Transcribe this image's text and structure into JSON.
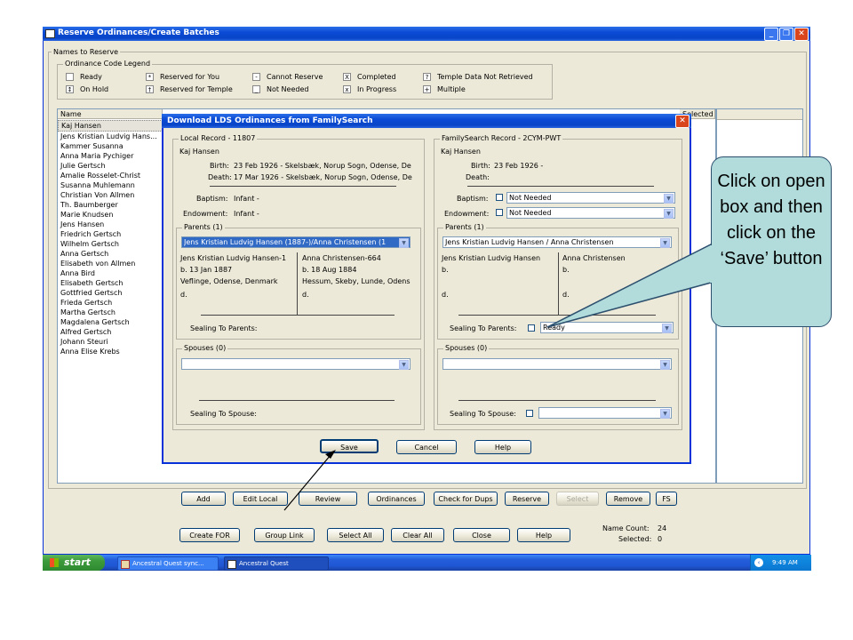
{
  "window": {
    "title": "Reserve Ordinances/Create Batches"
  },
  "names_group": {
    "label": "Names to Reserve"
  },
  "legend": {
    "label": "Ordinance Code Legend",
    "items": [
      {
        "code": "",
        "text": "Ready"
      },
      {
        "code": "*",
        "text": "Reserved for You"
      },
      {
        "code": "-",
        "text": "Cannot Reserve"
      },
      {
        "code": "X",
        "text": "Completed"
      },
      {
        "code": "?",
        "text": "Temple Data Not Retrieved"
      },
      {
        "code": "↕",
        "text": "On Hold"
      },
      {
        "code": "†",
        "text": "Reserved for Temple"
      },
      {
        "code": "_",
        "text": "Not Needed"
      },
      {
        "code": "x",
        "text": "In Progress"
      },
      {
        "code": "+",
        "text": "Multiple"
      }
    ]
  },
  "list": {
    "header_name": "Name",
    "header_selected": "Selected",
    "names": [
      "Kaj Hansen",
      "Jens Kristian Ludvig Hans...",
      "Kammer Susanna",
      "Anna Maria Pychiger",
      "Julie Gertsch",
      "Amalie Rosselet-Christ",
      "Susanna Muhlemann",
      "Christian Von Allmen",
      "Th. Baumberger",
      "Marie Knudsen",
      "Jens Hansen",
      "Friedrich Gertsch",
      "Wilhelm Gertsch",
      "Anna Gertsch",
      "Elisabeth von Allmen",
      "Anna Bird",
      "Elisabeth Gertsch",
      "Gottfried Gertsch",
      "Frieda Gertsch",
      "Martha Gertsch",
      "Magdalena Gertsch",
      "Alfred Gertsch",
      "Johann Steuri",
      "Anna Elise Krebs"
    ]
  },
  "dialog": {
    "title": "Download LDS Ordinances from FamilySearch",
    "local": {
      "label": "Local Record - 11807",
      "name": "Kaj Hansen",
      "birth_label": "Birth:",
      "birth": "23 Feb 1926 - Skelsbæk, Norup Sogn, Odense, De",
      "death_label": "Death:",
      "death": "17 Mar 1926 - Skelsbæk, Norup Sogn, Odense, De",
      "baptism_label": "Baptism:",
      "baptism": "Infant -",
      "endowment_label": "Endowment:",
      "endowment": "Infant -",
      "parents_label": "Parents (1)",
      "parents_select": "Jens Kristian Ludvig Hansen (1887-)/Anna Christensen (1",
      "father": [
        "Jens Kristian Ludvig Hansen-1",
        "b. 13 Jan 1887",
        "Veflinge, Odense, Denmark",
        "d."
      ],
      "mother": [
        "Anna Christensen-664",
        "b. 18 Aug 1884",
        "Hessum, Skeby, Lunde, Odens",
        "d."
      ],
      "sealing_parents": "Sealing To Parents:",
      "spouses_label": "Spouses (0)",
      "sealing_spouse": "Sealing To Spouse:"
    },
    "fs": {
      "label": "FamilySearch Record - 2CYM-PWT",
      "name": "Kaj Hansen",
      "birth_label": "Birth:",
      "birth": "23 Feb 1926 -",
      "death_label": "Death:",
      "baptism_label": "Baptism:",
      "baptism": "Not Needed",
      "endowment_label": "Endowment:",
      "endowment": "Not Needed",
      "parents_label": "Parents (1)",
      "parents_select": "Jens Kristian Ludvig Hansen / Anna Christensen",
      "father": [
        "Jens Kristian Ludvig Hansen",
        "b.",
        "",
        "d."
      ],
      "mother": [
        "Anna Christensen",
        "b.",
        "",
        "d."
      ],
      "sealing_parents": "Sealing To Parents:",
      "sealing_parents_value": "Ready",
      "spouses_label": "Spouses (0)",
      "sealing_spouse": "Sealing To Spouse:"
    },
    "buttons": {
      "save": "Save",
      "cancel": "Cancel",
      "help": "Help"
    }
  },
  "toolbar1": {
    "add": "Add",
    "edit_local": "Edit Local",
    "review": "Review",
    "ordinances": "Ordinances",
    "check_dups": "Check for Dups",
    "reserve": "Reserve",
    "select": "Select",
    "remove": "Remove",
    "fs": "FS"
  },
  "toolbar2": {
    "create_for": "Create FOR",
    "group_link": "Group Link",
    "select_all": "Select All",
    "clear_all": "Clear All",
    "close": "Close",
    "help": "Help"
  },
  "counts": {
    "name_count_label": "Name Count:",
    "name_count": "24",
    "selected_label": "Selected:",
    "selected": "0"
  },
  "taskbar": {
    "start": "start",
    "task1": "Ancestral Quest sync...",
    "task2": "Ancestral Quest",
    "time": "9:49 AM"
  },
  "callout": {
    "text": "Click on open box and then click on the ‘Save’ button"
  }
}
